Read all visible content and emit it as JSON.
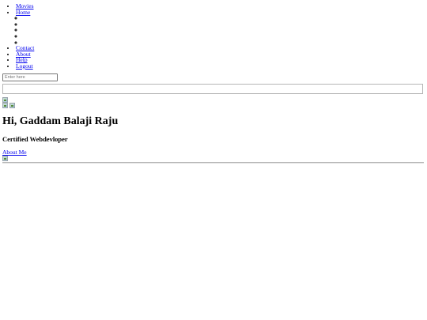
{
  "nav": {
    "items": [
      {
        "label": "Movies"
      },
      {
        "label": "Home"
      },
      {
        "label": "Contact"
      },
      {
        "label": "About"
      },
      {
        "label": "Help"
      },
      {
        "label": "Logout"
      }
    ],
    "home_subitems": [
      "",
      "",
      "",
      "",
      ""
    ]
  },
  "search": {
    "placeholder": "Enter here"
  },
  "profile": {
    "greeting": "Hi, Gaddam Balaji Raju",
    "title": "Certified Webdevloper",
    "about_link": "About Me"
  }
}
